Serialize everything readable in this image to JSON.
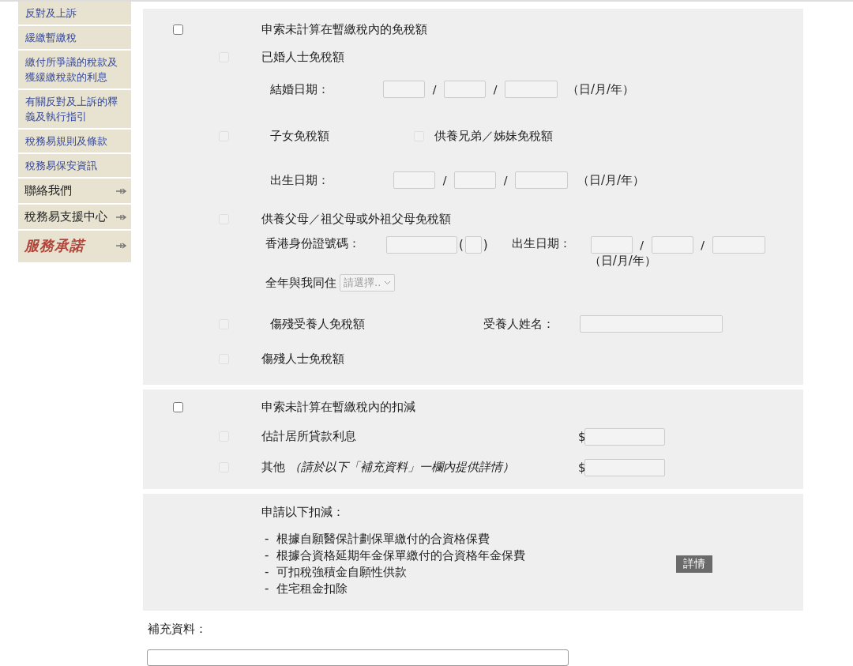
{
  "sidebar": {
    "items": [
      {
        "kind": "link",
        "label": "反對及上訴"
      },
      {
        "kind": "link",
        "label": "緩繳暫繳稅"
      },
      {
        "kind": "link",
        "label": "繳付所爭議的稅款及獲緩繳稅款的利息"
      },
      {
        "kind": "link",
        "label": "有關反對及上訴的釋義及執行指引"
      },
      {
        "kind": "link",
        "label": "稅務易規則及條款"
      },
      {
        "kind": "link",
        "label": "稅務易保安資訊"
      },
      {
        "kind": "menu",
        "label": "聯絡我們"
      },
      {
        "kind": "menu",
        "label": "稅務易支援中心"
      },
      {
        "kind": "logo",
        "label": "服務承諾"
      }
    ]
  },
  "allowances": {
    "label": "申索未計算在暫繳稅內的免稅額",
    "checked": false,
    "married": {
      "label": "已婚人士免稅額",
      "checked": false,
      "disabled": true,
      "date_label": "結婚日期：",
      "separators": [
        "/",
        "/"
      ],
      "date_hint": "（日/月/年）"
    },
    "children": {
      "label": "子女免稅額",
      "checked": false,
      "disabled": true,
      "siblings": {
        "label": "供養兄弟／姊妹免稅額",
        "checked": false,
        "disabled": true
      },
      "date_label": "出生日期：",
      "separators": [
        "/",
        "/"
      ],
      "date_hint": "（日/月/年）"
    },
    "parents": {
      "label": "供養父母／祖父母或外祖父母免稅額",
      "checked": false,
      "disabled": true,
      "hkid_label": "香港身份證號碼：",
      "paren_open": "(",
      "paren_close": ")",
      "date_label": "出生日期：",
      "separators": [
        "/",
        "/"
      ],
      "date_hint": "（日/月/年）",
      "live_label": "全年與我同住",
      "live_placeholder": "請選擇.."
    },
    "disabled_dependant": {
      "label": "傷殘受養人免稅額",
      "checked": false,
      "disabled": true,
      "name_label": "受養人姓名："
    },
    "disabled_person": {
      "label": "傷殘人士免稅額",
      "checked": false,
      "disabled": true
    }
  },
  "deductions": {
    "label": "申索未計算在暫繳稅內的扣減",
    "checked": false,
    "items": [
      {
        "label": "估計居所貸款利息",
        "currency": "$",
        "checked": false,
        "disabled": true
      },
      {
        "label": "其他 *（請於以下「補充資料」一欄內提供詳情）*",
        "currency": "$",
        "checked": false,
        "disabled": true
      }
    ]
  },
  "other_deductions": {
    "title": "申請以下扣減：",
    "items": [
      {
        "bullet": "-",
        "text": "根據自願醫保計劃保單繳付的合資格保費"
      },
      {
        "bullet": "-",
        "text": "根據合資格延期年金保單繳付的合資格年金保費"
      },
      {
        "bullet": "-",
        "text": "可扣稅強積金自願性供款"
      },
      {
        "bullet": "-",
        "text": "住宅租金扣除"
      }
    ],
    "button": "詳情"
  },
  "supplementary": {
    "label": "補充資料："
  }
}
